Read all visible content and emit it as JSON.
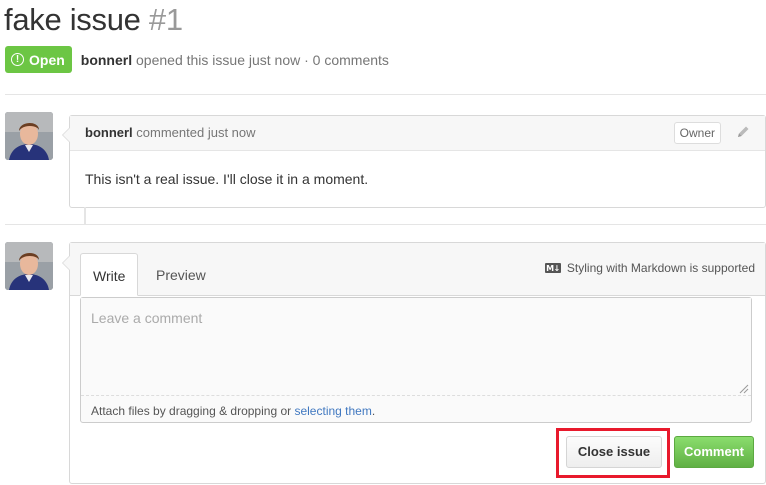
{
  "issue": {
    "title": "fake issue",
    "number": "#1",
    "state_label": "Open",
    "author": "bonnerl",
    "meta_text": "opened this issue just now · 0 comments"
  },
  "comment": {
    "author": "bonnerl",
    "action": "commented just now",
    "role_badge": "Owner",
    "body": "This isn't a real issue. I'll close it in a moment."
  },
  "form": {
    "tabs": [
      {
        "label": "Write",
        "active": true
      },
      {
        "label": "Preview",
        "active": false
      }
    ],
    "markdown_note": "Styling with Markdown is supported",
    "placeholder": "Leave a comment",
    "attach_text": "Attach files by dragging & dropping or ",
    "attach_link": "selecting them",
    "attach_suffix": ".",
    "close_button": "Close issue",
    "comment_button": "Comment"
  },
  "colors": {
    "open_green": "#6cc644",
    "comment_green": "#60b044",
    "link_blue": "#4078c0",
    "highlight_red": "#e8192c"
  },
  "icons": [
    "issue-opened-icon",
    "pencil-icon",
    "markdown-icon",
    "resize-handle-icon"
  ]
}
